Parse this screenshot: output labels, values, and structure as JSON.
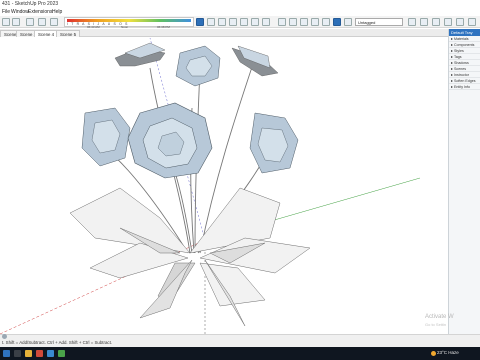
{
  "window": {
    "title": "431 - SketchUp Pro 2023"
  },
  "menu": {
    "items": [
      "File",
      "Window",
      "Extensions",
      "Help"
    ]
  },
  "toolbar": {
    "ruler_letters": "I T R A S I J A U S O S",
    "ruler_values": [
      "06:43 AM",
      "Noon",
      "06:38 PM"
    ],
    "layer_value": "Untagged"
  },
  "tabs": [
    "Scene 2",
    "Scene 3",
    "Scene 4",
    "Scene 5"
  ],
  "active_tab_index": 2,
  "tray": {
    "title": "Default Tray",
    "items": [
      "Materials",
      "Components",
      "Styles",
      "Tags",
      "Shadows",
      "Scenes",
      "Instructor",
      "Soften Edges",
      "Entity Info"
    ]
  },
  "watermark": {
    "line1": "Activate W",
    "line2": "Go to Settin"
  },
  "status": {
    "text": "t. Shift = Add/Subtract. Ctrl + Add. Shift + Ctrl = Subtract."
  },
  "taskbar": {
    "weather": "23°C  Haze"
  },
  "colors": {
    "accent": "#2f73c0",
    "flower": "#b7c8d8",
    "taskbar": "#0f1620"
  }
}
